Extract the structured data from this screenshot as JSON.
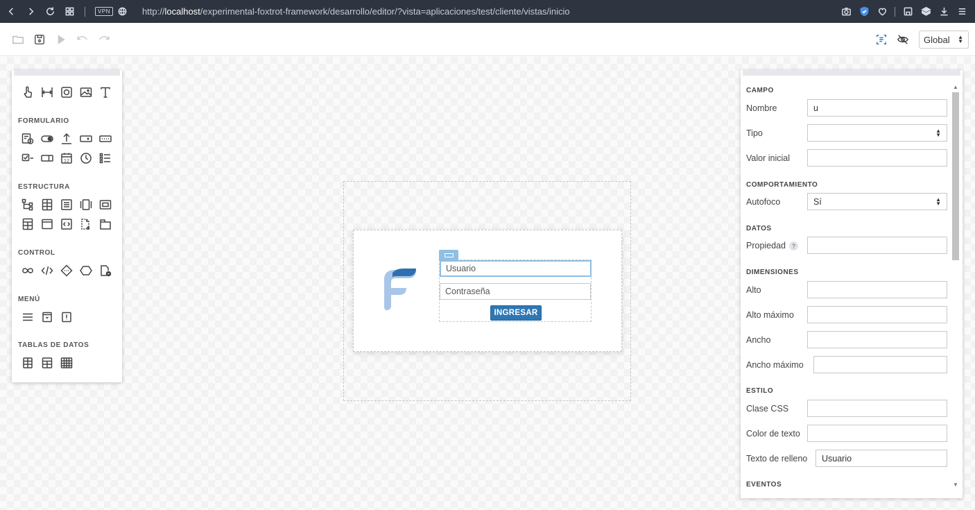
{
  "browser": {
    "vpn_label": "VPN",
    "url_prefix": "http://",
    "url_host": "localhost",
    "url_path": "/experimental-foxtrot-framework/desarrollo/editor/?vista=aplicaciones/test/cliente/vistas/inicio"
  },
  "toolbar": {
    "scope_value": "Global"
  },
  "palette": {
    "sections": {
      "formulario": "FORMULARIO",
      "estructura": "ESTRUCTURA",
      "control": "CONTROL",
      "menu": "MENÚ",
      "tablas": "TABLAS DE DATOS"
    }
  },
  "design": {
    "username_placeholder": "Usuario",
    "password_placeholder": "Contraseña",
    "login_button": "INGRESAR"
  },
  "properties": {
    "sections": {
      "campo": "CAMPO",
      "comportamiento": "COMPORTAMIENTO",
      "datos": "DATOS",
      "dimensiones": "DIMENSIONES",
      "estilo": "ESTILO",
      "eventos": "EVENTOS"
    },
    "fields": {
      "nombre_label": "Nombre",
      "nombre_value": "u",
      "tipo_label": "Tipo",
      "tipo_value": "",
      "valor_inicial_label": "Valor inicial",
      "valor_inicial_value": "",
      "autofoco_label": "Autofoco",
      "autofoco_value": "Sí",
      "propiedad_label": "Propiedad",
      "propiedad_help": "?",
      "propiedad_value": "",
      "alto_label": "Alto",
      "alto_maximo_label": "Alto máximo",
      "ancho_label": "Ancho",
      "ancho_maximo_label": "Ancho máximo",
      "clase_css_label": "Clase CSS",
      "color_texto_label": "Color de texto",
      "texto_relleno_label": "Texto de relleno",
      "texto_relleno_value": "Usuario"
    }
  }
}
